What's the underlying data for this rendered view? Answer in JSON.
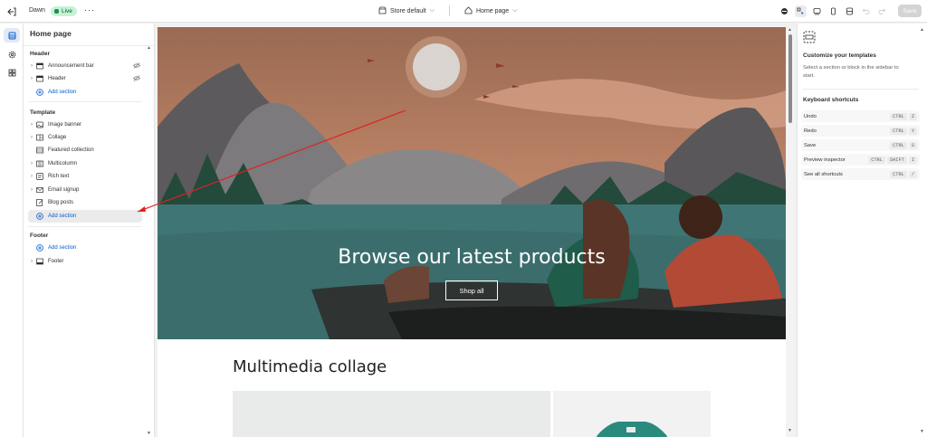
{
  "topbar": {
    "theme_name": "Dawn",
    "status_badge": "Live",
    "more_label": "···",
    "store_selector": "Store default",
    "page_selector": "Home page",
    "save_label": "Save"
  },
  "sidebar": {
    "title": "Home page",
    "groups": {
      "header": {
        "label": "Header",
        "items": [
          {
            "label": "Announcement bar",
            "icon": "announcement-icon"
          },
          {
            "label": "Header",
            "icon": "header-icon"
          }
        ],
        "add_label": "Add section"
      },
      "template": {
        "label": "Template",
        "items": [
          {
            "label": "Image banner",
            "icon": "image-icon"
          },
          {
            "label": "Collage",
            "icon": "collage-icon"
          },
          {
            "label": "Featured collection",
            "icon": "collection-icon"
          },
          {
            "label": "Multicolumn",
            "icon": "columns-icon"
          },
          {
            "label": "Rich text",
            "icon": "text-icon"
          },
          {
            "label": "Email signup",
            "icon": "email-icon"
          },
          {
            "label": "Blog posts",
            "icon": "blog-icon"
          }
        ],
        "add_label": "Add section"
      },
      "footer": {
        "label": "Footer",
        "add_label": "Add section",
        "items": [
          {
            "label": "Footer",
            "icon": "footer-icon"
          }
        ]
      }
    }
  },
  "preview": {
    "hero_title": "Browse our latest products",
    "hero_button": "Shop all",
    "collage_title": "Multimedia collage"
  },
  "right_panel": {
    "title": "Customize your templates",
    "description": "Select a section or block in the sidebar to start.",
    "shortcuts_heading": "Keyboard shortcuts",
    "shortcuts": [
      {
        "label": "Undo",
        "keys": [
          "CTRL",
          "Z"
        ]
      },
      {
        "label": "Redo",
        "keys": [
          "CTRL",
          "Y"
        ]
      },
      {
        "label": "Save",
        "keys": [
          "CTRL",
          "S"
        ]
      },
      {
        "label": "Preview inspector",
        "keys": [
          "CTRL",
          "SHIFT",
          "I"
        ]
      },
      {
        "label": "See all shortcuts",
        "keys": [
          "CTRL",
          "/"
        ]
      }
    ]
  },
  "colors": {
    "accent": "#005bd3",
    "live_badge_bg": "#c4f5d3",
    "annotation_arrow": "#e02020"
  }
}
